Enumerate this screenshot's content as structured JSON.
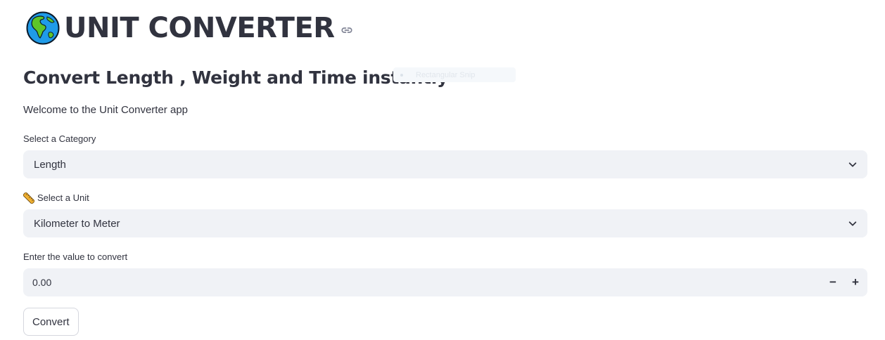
{
  "header": {
    "title": "UNIT CONVERTER",
    "title_icon": "globe-americas-icon",
    "anchor_icon": "link-icon"
  },
  "subheader": "Convert Length , Weight and Time instantly",
  "overlay": {
    "label": "Rectangular Snip"
  },
  "welcome_text": "Welcome to the Unit Converter app",
  "category": {
    "label": "Select a Category",
    "selected": "Length"
  },
  "unit": {
    "label_icon": "ruler-icon",
    "label": "Select a Unit",
    "selected": "Kilometer to Meter"
  },
  "value": {
    "label": "Enter the value to convert",
    "current": "0.00",
    "decrement": "−",
    "increment": "+"
  },
  "convert_button": "Convert",
  "colors": {
    "text": "#31333f",
    "input_bg": "#f0f2f6",
    "button_border": "#d5d7de"
  }
}
